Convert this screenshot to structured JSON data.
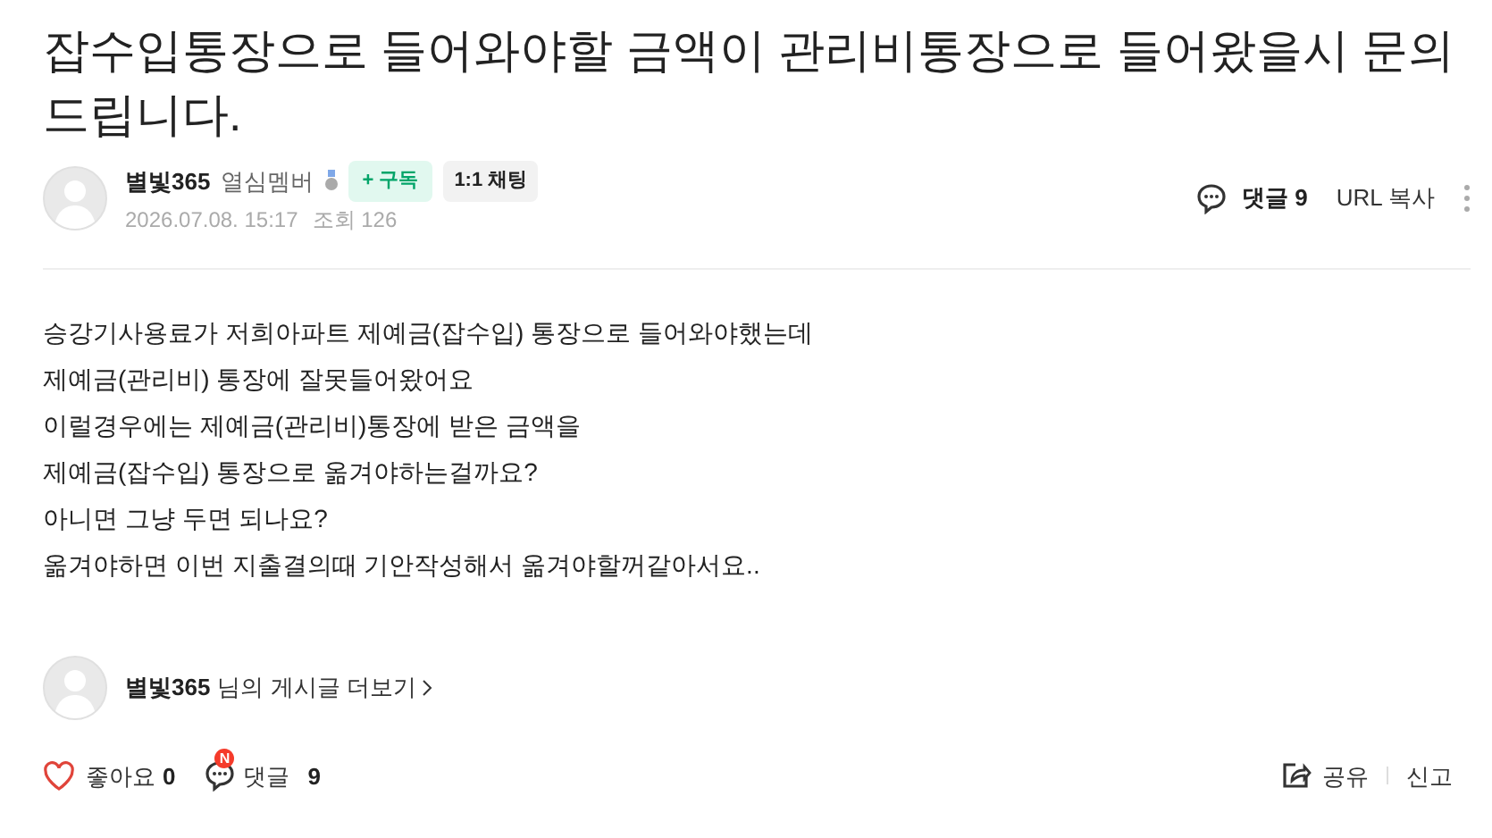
{
  "title": "잡수입통장으로 들어와야할 금액이 관리비통장으로 들어왔을시 문의드립니다.",
  "author": {
    "name": "별빛365",
    "grade": "열심멤버",
    "subscribe": "+ 구독",
    "chat": "1:1 채팅",
    "date": "2026.07.08. 15:17",
    "views": "조회 126"
  },
  "actions": {
    "comments": "댓글 9",
    "copy_url": "URL 복사"
  },
  "body": [
    "승강기사용료가 저희아파트 제예금(잡수입) 통장으로 들어와야했는데",
    "제예금(관리비) 통장에 잘못들어왔어요",
    "이럴경우에는 제예금(관리비)통장에 받은 금액을",
    "제예금(잡수입) 통장으로 옮겨야하는걸까요?",
    "아니면 그냥 두면 되나요?",
    "옮겨야하면 이번 지출결의때 기안작성해서 옮겨야할꺼같아서요.."
  ],
  "more_posts": {
    "name": "별빛365",
    "text": "님의 게시글 더보기"
  },
  "footer": {
    "like_label": "좋아요",
    "like_count": "0",
    "comment_badge": "N",
    "comment_label": "댓글",
    "comment_count": "9",
    "share": "공유",
    "report": "신고"
  }
}
